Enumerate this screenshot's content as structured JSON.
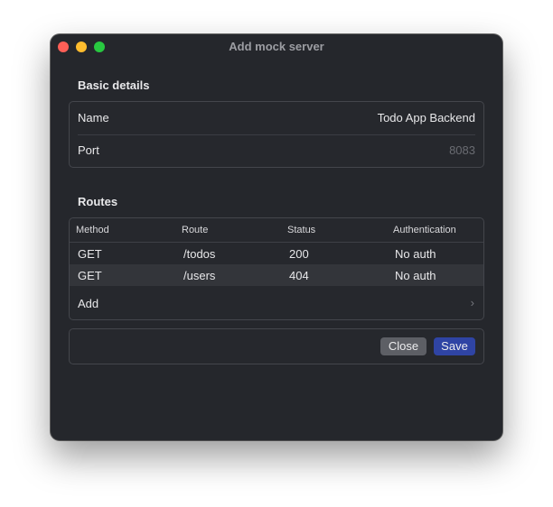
{
  "window": {
    "title": "Add mock server"
  },
  "basic_details": {
    "heading": "Basic details",
    "name_label": "Name",
    "name_value": "Todo App Backend",
    "port_label": "Port",
    "port_placeholder": "8083"
  },
  "routes": {
    "heading": "Routes",
    "columns": [
      "Method",
      "Route",
      "Status",
      "Authentication"
    ],
    "rows": [
      {
        "method": "GET",
        "route": "/todos",
        "status": "200",
        "auth": "No auth"
      },
      {
        "method": "GET",
        "route": "/users",
        "status": "404",
        "auth": "No auth"
      }
    ],
    "add_label": "Add",
    "add_icon": "›"
  },
  "actions": {
    "close_label": "Close",
    "save_label": "Save"
  },
  "colors": {
    "window_bg": "#25272c",
    "accent_save": "#2f44a4",
    "button_close": "#5d5f65",
    "row_alt": "#33353a"
  }
}
